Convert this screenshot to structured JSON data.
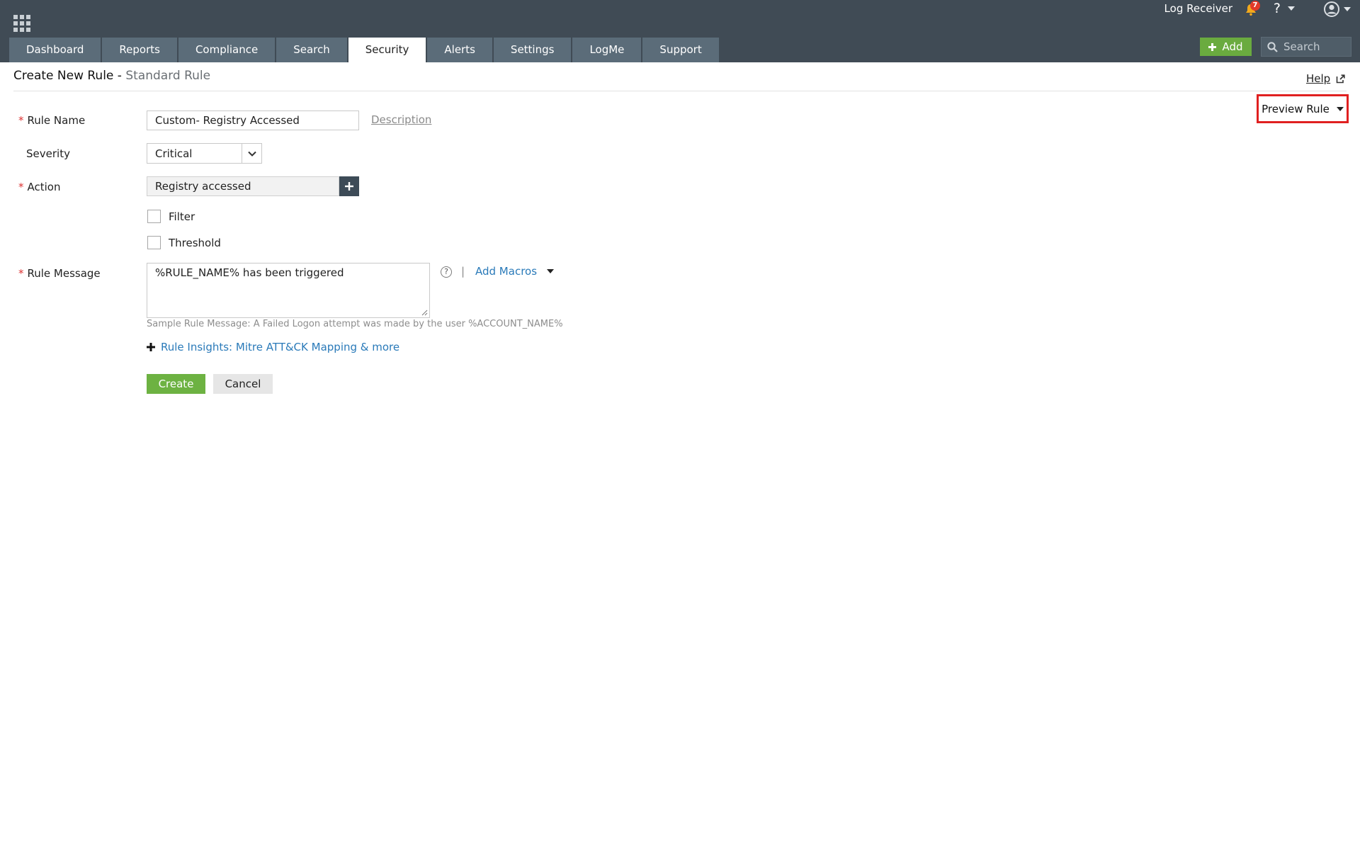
{
  "header": {
    "log_receiver": "Log Receiver",
    "notification_count": "7",
    "help_symbol": "?",
    "add_label": "Add",
    "search_placeholder": "Search"
  },
  "tabs": [
    {
      "label": "Dashboard"
    },
    {
      "label": "Reports"
    },
    {
      "label": "Compliance"
    },
    {
      "label": "Search"
    },
    {
      "label": "Security",
      "active": true
    },
    {
      "label": "Alerts"
    },
    {
      "label": "Settings"
    },
    {
      "label": "LogMe"
    },
    {
      "label": "Support"
    }
  ],
  "page": {
    "title": "Create New Rule",
    "separator": " - ",
    "subtitle": "Standard Rule",
    "help_label": "Help",
    "preview_rule_label": "Preview Rule"
  },
  "form": {
    "required_marker": "*",
    "rule_name_label": "Rule Name",
    "rule_name_value": "Custom- Registry Accessed",
    "description_link": "Description",
    "severity_label": "Severity",
    "severity_value": "Critical",
    "action_label": "Action",
    "action_value": "Registry accessed",
    "filter_label": "Filter",
    "threshold_label": "Threshold",
    "rule_message_label": "Rule Message",
    "rule_message_value": "%RULE_NAME% has been triggered",
    "help_icon_symbol": "?",
    "pipe": "|",
    "add_macros_label": "Add Macros",
    "sample_message": "Sample Rule Message: A Failed Logon attempt was made by the user %ACCOUNT_NAME%",
    "insights_label": "Rule Insights: Mitre ATT&CK Mapping & more",
    "create_label": "Create",
    "cancel_label": "Cancel"
  },
  "colors": {
    "header_bg": "#404b55",
    "tab_bg": "#5b6c79",
    "add_green": "#6aab3f",
    "link_blue": "#2a7ab9",
    "highlight_red": "#e02020"
  },
  "icons": [
    "apps-grid-icon",
    "bell-icon",
    "user-avatar-icon",
    "search-icon",
    "plus-icon",
    "chevron-down-icon",
    "help-circle-icon",
    "external-link-icon",
    "resize-grip-icon"
  ]
}
